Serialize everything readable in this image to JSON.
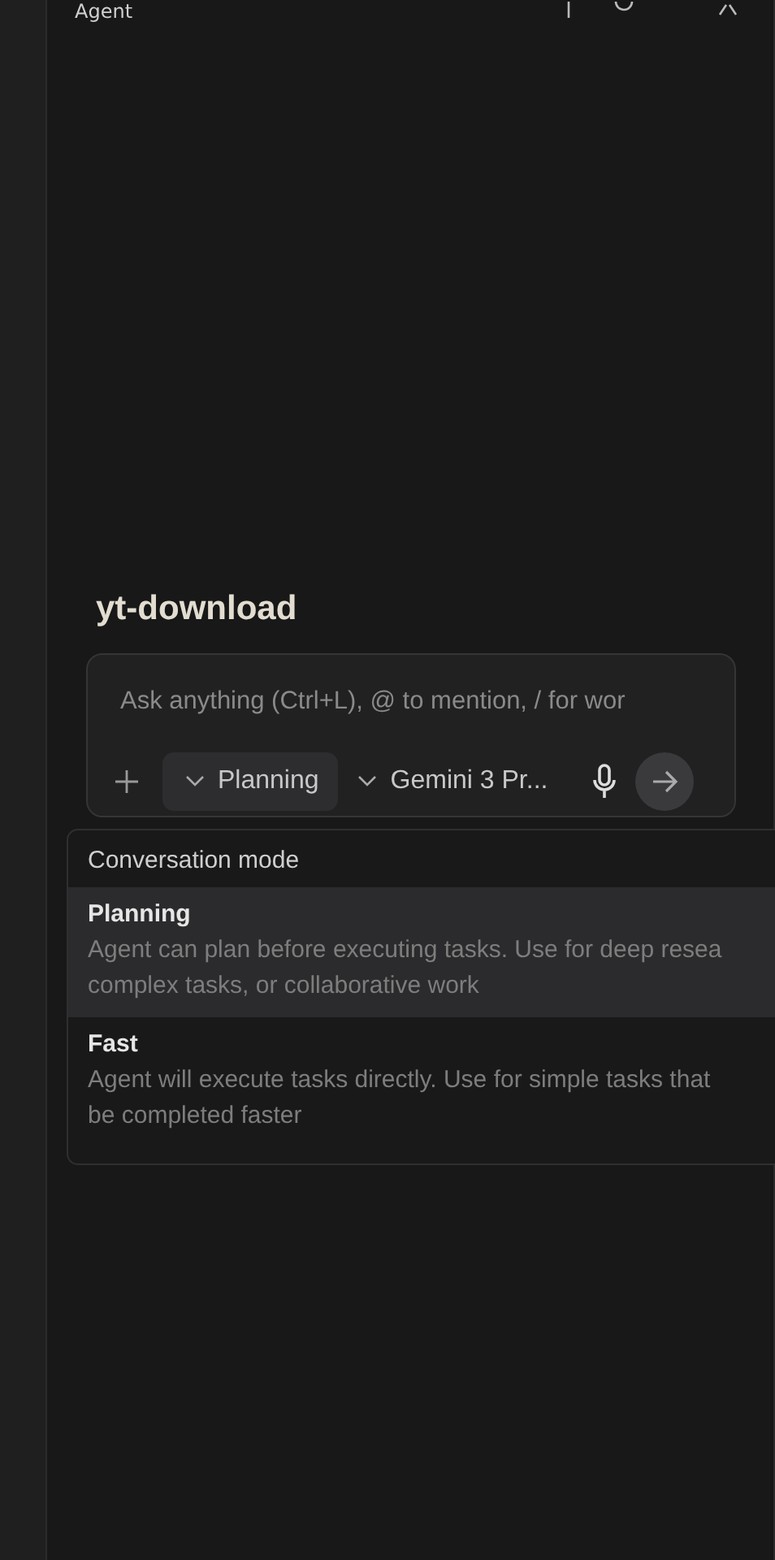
{
  "header": {
    "title": "Agent"
  },
  "project": {
    "title": "yt-download"
  },
  "composer": {
    "placeholder": "Ask anything (Ctrl+L), @ to mention, / for wor",
    "mode": {
      "label": "Planning",
      "open": true
    },
    "model": {
      "label": "Gemini 3 Pr..."
    }
  },
  "mode_menu": {
    "heading": "Conversation mode",
    "items": [
      {
        "title": "Planning",
        "description_lines": [
          "Agent can plan before executing tasks. Use for deep resea",
          "complex tasks, or collaborative work"
        ],
        "selected": true
      },
      {
        "title": "Fast",
        "description_lines": [
          "Agent will execute tasks directly. Use for simple tasks that",
          "be completed faster"
        ],
        "selected": false
      }
    ]
  }
}
